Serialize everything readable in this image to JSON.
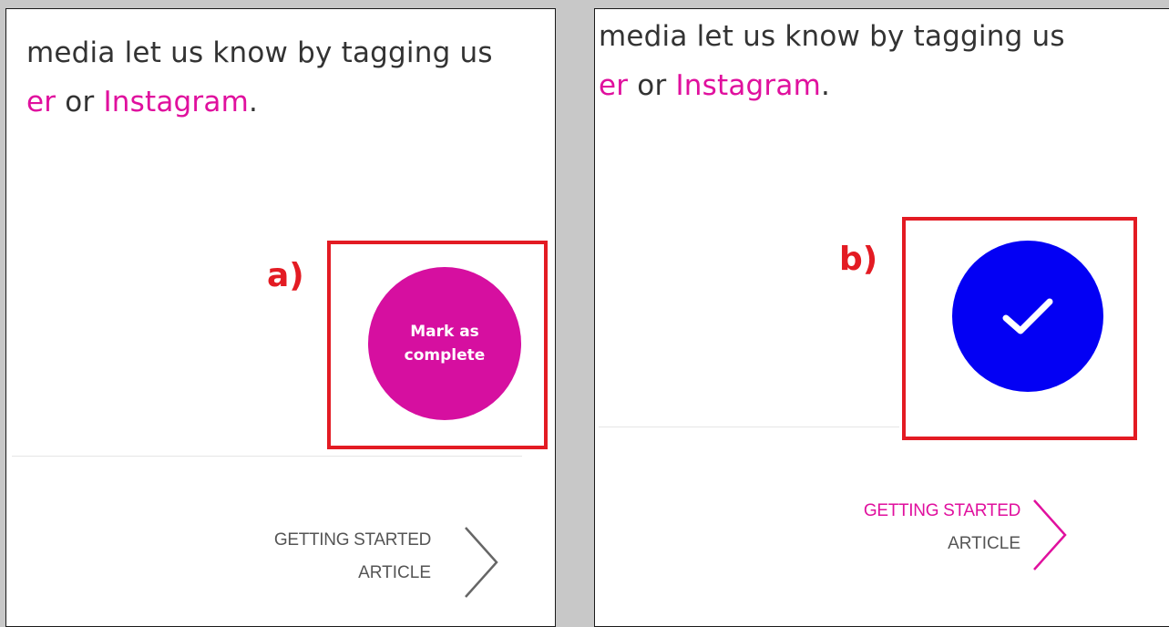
{
  "colors": {
    "accent_pink": "#e0109e",
    "button_pink": "#d60fa0",
    "complete_blue": "#0300f4",
    "annotation_red": "#e31b23"
  },
  "panel_a": {
    "tag": "a)",
    "line1": "media let us know by tagging us",
    "line2_prefix": "er",
    "line2_middle": " or ",
    "line2_link": "Instagram",
    "line2_end": ".",
    "button_label_1": "Mark as",
    "button_label_2": "complete",
    "nav_category": "GETTING STARTED",
    "nav_type": "ARTICLE",
    "nav_icon": "chevron-right-icon"
  },
  "panel_b": {
    "tag": "b)",
    "line1": "media let us know by tagging us",
    "line2_prefix": "er",
    "line2_middle": " or ",
    "line2_link": "Instagram",
    "line2_end": ".",
    "button_icon": "checkmark-icon",
    "nav_category": "GETTING STARTED",
    "nav_type": "ARTICLE",
    "nav_icon": "chevron-right-icon"
  }
}
